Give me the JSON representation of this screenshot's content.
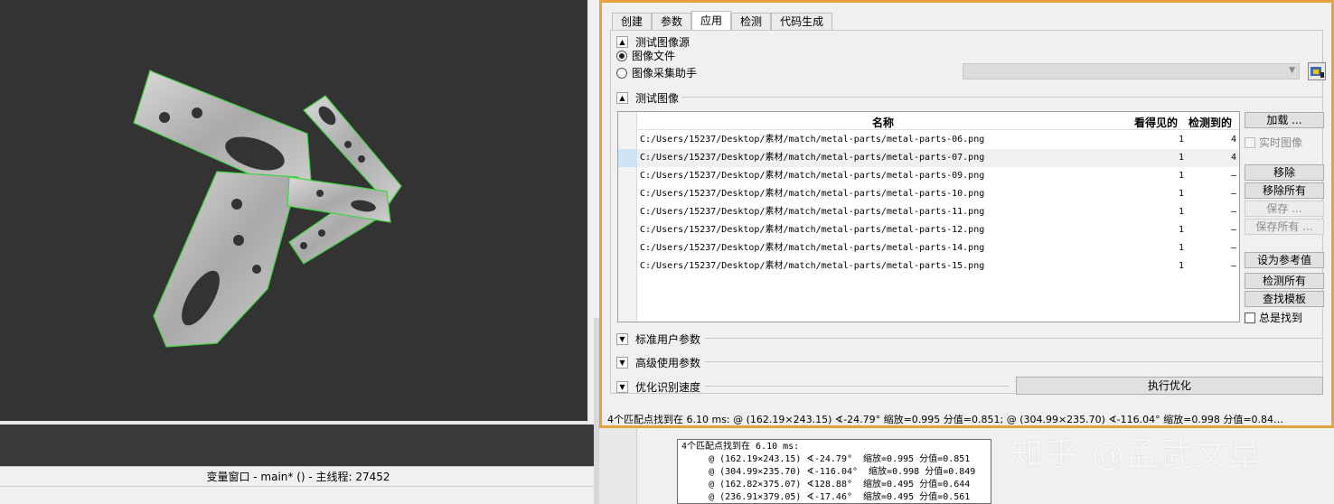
{
  "tabs": [
    {
      "label": "创建",
      "active": false
    },
    {
      "label": "参数",
      "active": false
    },
    {
      "label": "应用",
      "active": true
    },
    {
      "label": "检测",
      "active": false
    },
    {
      "label": "代码生成",
      "active": false
    }
  ],
  "source_section": {
    "title": "测试图像源",
    "option_file": "图像文件",
    "option_grab": "图像采集助手",
    "selected": "图像文件",
    "combo_value": ""
  },
  "images_section": {
    "title": "测试图像",
    "columns": {
      "name": "名称",
      "seen": "看得见的",
      "detected": "检测到的"
    },
    "rows": [
      {
        "path": "C:/Users/15237/Desktop/素材/match/metal-parts/metal-parts-06.png",
        "seen": "1",
        "detected": "4"
      },
      {
        "path": "C:/Users/15237/Desktop/素材/match/metal-parts/metal-parts-07.png",
        "seen": "1",
        "detected": "4"
      },
      {
        "path": "C:/Users/15237/Desktop/素材/match/metal-parts/metal-parts-09.png",
        "seen": "1",
        "detected": "–"
      },
      {
        "path": "C:/Users/15237/Desktop/素材/match/metal-parts/metal-parts-10.png",
        "seen": "1",
        "detected": "–"
      },
      {
        "path": "C:/Users/15237/Desktop/素材/match/metal-parts/metal-parts-11.png",
        "seen": "1",
        "detected": "–"
      },
      {
        "path": "C:/Users/15237/Desktop/素材/match/metal-parts/metal-parts-12.png",
        "seen": "1",
        "detected": "–"
      },
      {
        "path": "C:/Users/15237/Desktop/素材/match/metal-parts/metal-parts-14.png",
        "seen": "1",
        "detected": "–"
      },
      {
        "path": "C:/Users/15237/Desktop/素材/match/metal-parts/metal-parts-15.png",
        "seen": "1",
        "detected": "–"
      }
    ],
    "selected_row": 1
  },
  "side_buttons": {
    "load": "加载 ...",
    "live": "实时图像",
    "remove": "移除",
    "remove_all": "移除所有",
    "save": "保存 ...",
    "save_all": "保存所有 ...",
    "set_reference": "设为参考值",
    "detect_all": "检测所有",
    "find_model": "查找模板",
    "always_find": "总是找到"
  },
  "collapsed_sections": {
    "standard": "标准用户参数",
    "advanced": "高级使用参数",
    "optimize": "优化识别速度"
  },
  "optimize_button": "执行优化",
  "result_text": "4个匹配点找到在 6.10 ms: @ (162.19×243.15) ∢-24.79°  缩放=0.995 分值=0.851; @ (304.99×235.70) ∢-116.04°  缩放=0.998 分值=0.84…",
  "statusbar_text": "变量窗口 - main* () - 主线程: 27452",
  "tooltip_lines": [
    "4个匹配点找到在 6.10 ms:",
    "     @ (162.19×243.15) ∢-24.79°  缩放=0.995 分值=0.851",
    "     @ (304.99×235.70) ∢-116.04°  缩放=0.998 分值=0.849",
    "     @ (162.82×375.07) ∢128.88°  缩放=0.495 分值=0.644",
    "     @ (236.91×379.05) ∢-17.46°  缩放=0.495 分值=0.561"
  ],
  "watermark": "知乎 @孟武文阜",
  "colors": {
    "accent": "#e6a23c",
    "match_outline": "#3fd43f",
    "image_bg": "#333333"
  }
}
